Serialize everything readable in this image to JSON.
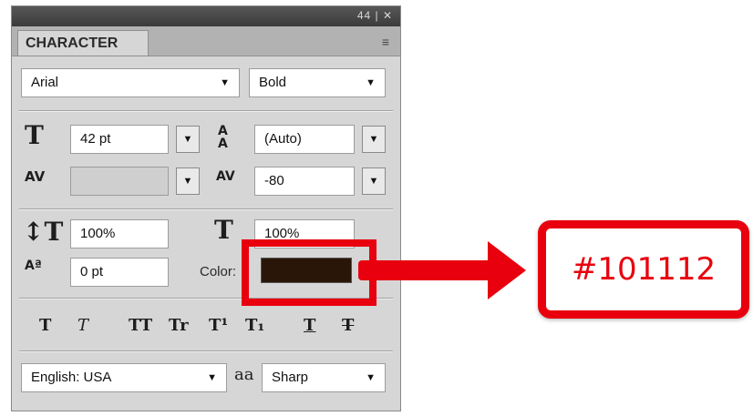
{
  "panel": {
    "title_icons": "44 | ✕",
    "tab_label": "CHARACTER",
    "menu_icon": "≡"
  },
  "font": {
    "family": "Arial",
    "style": "Bold"
  },
  "metrics": {
    "size": "42 pt",
    "leading": "(Auto)",
    "kerning": "",
    "tracking": "-80",
    "vertical_scale": "100%",
    "horizontal_scale": "100%",
    "baseline_shift": "0 pt",
    "color_label": "Color:",
    "color_hex": "#101112"
  },
  "style_buttons": [
    "T",
    "T",
    "TT",
    "Tr",
    "T¹",
    "T₁",
    "T",
    "T"
  ],
  "bottom": {
    "language": "English: USA",
    "aa_icon": "aa",
    "antialias": "Sharp"
  },
  "annotation": {
    "callout_text": "#101112",
    "accent": "#e8000e"
  }
}
